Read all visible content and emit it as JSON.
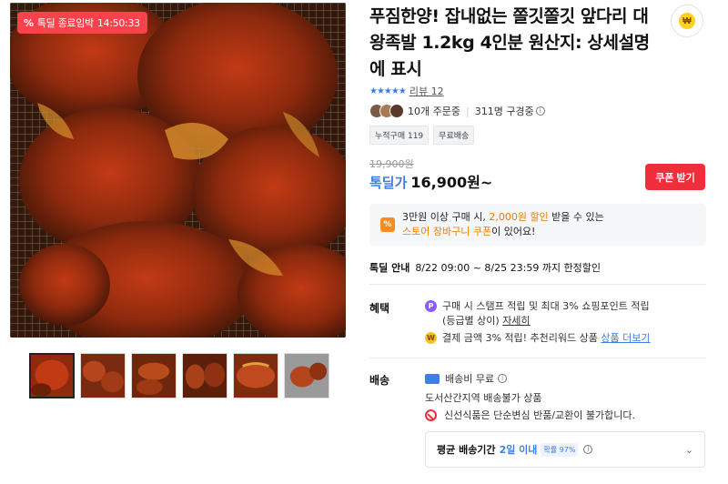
{
  "deal_badge": {
    "icon": "percent-icon",
    "label": "톡딜 종료임박",
    "countdown": "14:50:33"
  },
  "thumbnails_count": 6,
  "product": {
    "title": "푸짐한양! 잡내없는 쫄깃쫄깃 앞다리 대왕족발 1.2kg 4인분 원산지: 상세설명에 표시",
    "rating_stars": "★★★★★",
    "review_label": "리뷰 12",
    "order_count": "10개 주문중",
    "viewer_count": "311명 구경중",
    "tags": [
      "누적구매 119",
      "무료배송"
    ],
    "original_price": "19,900원",
    "price_label": "톡딜가",
    "price": "16,900원~",
    "coupon_button": "쿠폰 받기"
  },
  "coupon_notice": {
    "icon_text": "%",
    "part1": "3만원 이상 구매 시, ",
    "highlight1": "2,000원 할인",
    "part2": " 받을 수 있는",
    "highlight2": "스토어 장바구니 쿠폰",
    "part3": "이 있어요!"
  },
  "deal_info": {
    "label": "톡딜 안내",
    "text": "8/22 09:00 ~ 8/25 23:59 까지 한정할인"
  },
  "benefits": {
    "label": "혜택",
    "line1_icon": "P",
    "line1_text": "구매 시 스탬프 적립 및 최대 3% 쇼핑포인트 적립",
    "line1b_text": "(등급별 상이) ",
    "line1_link": "자세히",
    "line2_icon": "W",
    "line2_text": "결제 금액 3% 적립! 추천리워드 상품 ",
    "line2_link": "상품 더보기"
  },
  "shipping": {
    "label": "배송",
    "free_label": "배송비 무료",
    "restriction": "도서산간지역 배송불가 상품",
    "no_return": "신선식품은 단순변심 반품/교환이 불가합니다.",
    "avg_label": "평균 배송기간",
    "avg_value": "2일 이내",
    "avg_pill": "확률 97%"
  },
  "colors": {
    "accent_blue": "#3d7ee8",
    "accent_red": "#f02d3a",
    "highlight_orange": "#f57c00"
  }
}
